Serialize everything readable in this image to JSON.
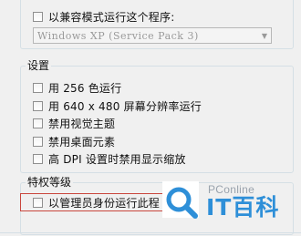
{
  "compat": {
    "checkbox_label": "以兼容模式运行这个程序:",
    "checked": false,
    "os_select_value": "Windows XP (Service Pack 3)"
  },
  "settings": {
    "title": "设置",
    "options": [
      {
        "label": "用 256 色运行",
        "checked": false
      },
      {
        "label": "用 640 x 480 屏幕分辨率运行",
        "checked": false
      },
      {
        "label": "禁用视觉主题",
        "checked": false
      },
      {
        "label": "禁用桌面元素",
        "checked": false
      },
      {
        "label": "高 DPI 设置时禁用显示缩放",
        "checked": false
      }
    ]
  },
  "privilege": {
    "title": "特权等级",
    "admin_label": "以管理员身份运行此程",
    "checked": false,
    "highlight_color": "#c9463d"
  },
  "watermark": {
    "site": "PConline",
    "brand": "IT百科",
    "icon": "search-magnifier-logo-icon",
    "color": "#2e8fd8"
  }
}
